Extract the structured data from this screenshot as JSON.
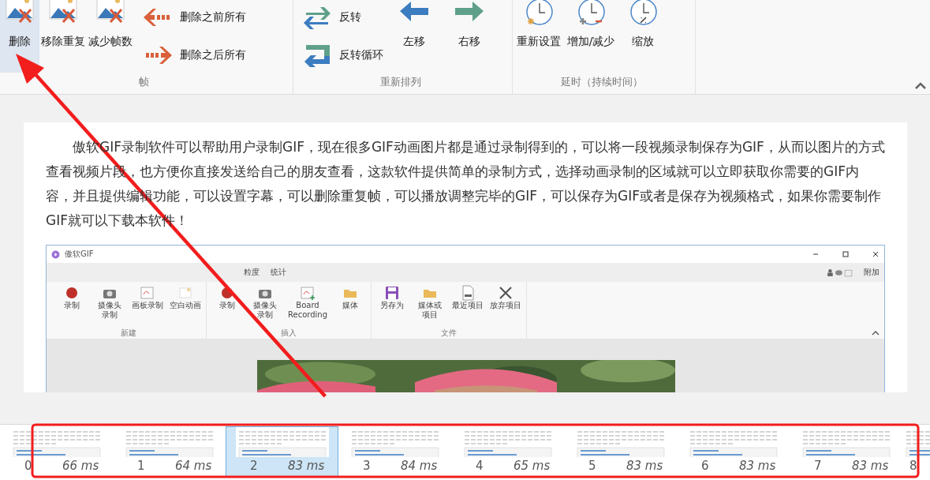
{
  "ribbon": {
    "groups": [
      {
        "label": "帧",
        "items": [
          {
            "kind": "large",
            "label": "删除",
            "selected": true
          },
          {
            "kind": "large",
            "label": "移除重复",
            "selected": false
          },
          {
            "kind": "large",
            "label": "减少帧数",
            "selected": false
          },
          {
            "kind": "stack",
            "items": [
              {
                "label": "删除之前所有"
              },
              {
                "label": "删除之后所有"
              }
            ]
          }
        ]
      },
      {
        "label": "重新排列",
        "items": [
          {
            "kind": "stack",
            "items": [
              {
                "label": "反转"
              },
              {
                "label": "反转循环"
              }
            ]
          },
          {
            "kind": "large",
            "label": "左移",
            "selected": false
          },
          {
            "kind": "large",
            "label": "右移",
            "selected": false
          }
        ]
      },
      {
        "label": "延时（持续时间）",
        "items": [
          {
            "kind": "large",
            "label": "重新设置",
            "selected": false
          },
          {
            "kind": "large",
            "label": "增加/减少",
            "selected": false
          },
          {
            "kind": "large",
            "label": "缩放",
            "selected": false
          }
        ]
      }
    ]
  },
  "article": {
    "paragraph": "傲软GIF录制软件可以帮助用户录制GIF，现在很多GIF动画图片都是通过录制得到的，可以将一段视频录制保存为GIF，从而以图片的方式查看视频片段，也方便你直接发送给自己的朋友查看，这款软件提供简单的录制方式，选择动画录制的区域就可以立即获取你需要的GIF内容，并且提供编辑功能，可以设置字幕，可以删除重复帧，可以播放调整完毕的GIF，可以保存为GIF或者是保存为视频格式，如果你需要制作GIF就可以下载本软件！",
    "screenshot": {
      "title": "傲软GIF",
      "tabs": [
        "粒度",
        "统计"
      ],
      "extra": "附加",
      "groups": [
        {
          "label": "新建",
          "items": [
            "录制",
            "摄像头录制",
            "画板录制",
            "空白动画"
          ]
        },
        {
          "label": "插入",
          "items": [
            "录制",
            "摄像头录制",
            "Board Recording",
            "媒体"
          ]
        },
        {
          "label": "文件",
          "items": [
            "另存为",
            "媒体或项目",
            "最近项目",
            "放弃项目"
          ]
        }
      ],
      "picture": {
        "kind": "picture"
      }
    }
  },
  "frames": [
    {
      "number": "0",
      "duration": "66 ms",
      "selected": false
    },
    {
      "number": "1",
      "duration": "64 ms",
      "selected": false
    },
    {
      "number": "2",
      "duration": "83 ms",
      "selected": true
    },
    {
      "number": "3",
      "duration": "84 ms",
      "selected": false
    },
    {
      "number": "4",
      "duration": "65 ms",
      "selected": false
    },
    {
      "number": "5",
      "duration": "83 ms",
      "selected": false
    },
    {
      "number": "6",
      "duration": "83 ms",
      "selected": false
    },
    {
      "number": "7",
      "duration": "83 ms",
      "selected": false
    },
    {
      "number": "8",
      "selected": false,
      "partial": true
    }
  ],
  "annotations": {
    "arrow": true,
    "highlight_box": true
  }
}
